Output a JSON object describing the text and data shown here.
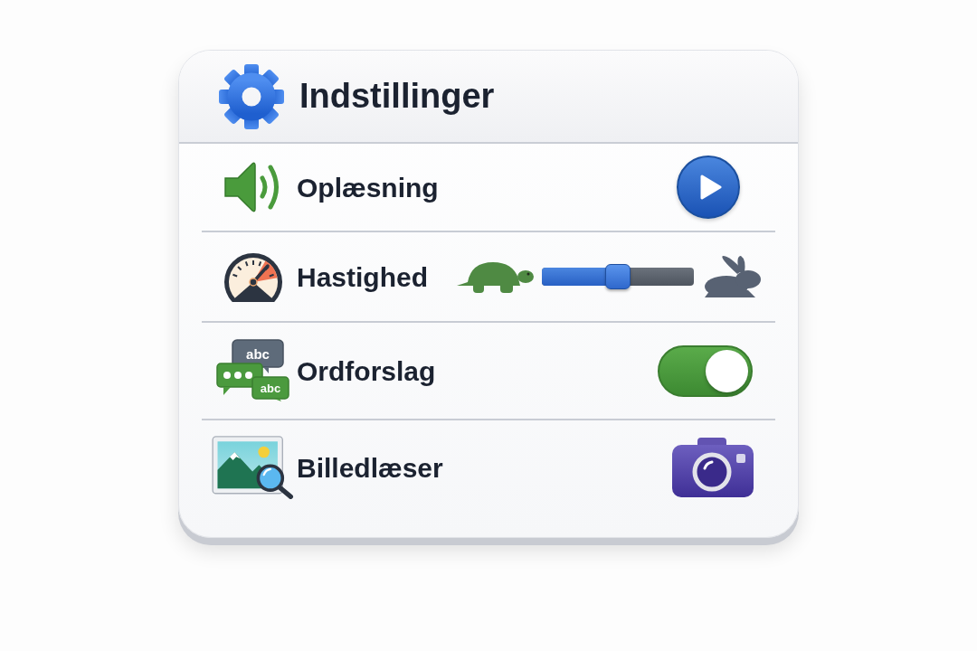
{
  "header": {
    "title": "Indstillinger"
  },
  "rows": [
    {
      "kind": "play",
      "label": "Oplæsning"
    },
    {
      "kind": "slider",
      "label": "Hastighed",
      "level": 0.5
    },
    {
      "kind": "switch",
      "label": "Ordforslag",
      "on": true,
      "icon_labels": [
        "abc",
        "abc"
      ]
    },
    {
      "kind": "camera",
      "label": "Billedlæser"
    }
  ]
}
